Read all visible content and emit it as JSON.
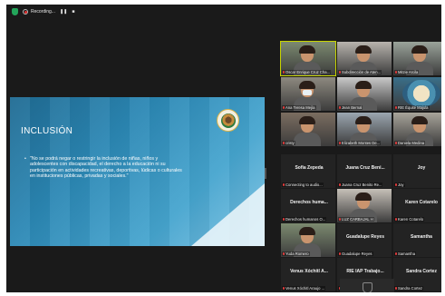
{
  "app": {
    "recording_label": "Recording...",
    "pause_glyph": "❚❚",
    "stop_glyph": "■"
  },
  "slide": {
    "title": "INCLUSIÓN",
    "bullet": "\"No se podrá negar o restringir la inclusión de niñas, niños y adolescentes con discapacidad, el derecho a la educación ni su participación en actividades recreativas, deportivas, lúdicas o culturales en instituciones públicas, privadas y sociales.\""
  },
  "participants": [
    {
      "label": "Oscar Enrique Cruz Cha...",
      "name": "",
      "video": true,
      "active": true
    },
    {
      "label": "Subdirección de Aten...",
      "name": "",
      "video": true
    },
    {
      "label": "Mitzie Arcila",
      "name": "",
      "video": true
    },
    {
      "label": "Ana Teresa Mejía",
      "name": "",
      "video": true
    },
    {
      "label": "Jean Bernal",
      "name": "",
      "video": true
    },
    {
      "label": "RIE Équité Majula",
      "name": "",
      "video": true
    },
    {
      "label": "cristy",
      "name": "",
      "video": true
    },
    {
      "label": "Elizabeth Montes De...",
      "name": "",
      "video": true
    },
    {
      "label": "Daniela Medina",
      "name": "",
      "video": true
    },
    {
      "label": "Connecting to audio...",
      "name": "Sofia Zepeda",
      "video": false
    },
    {
      "label": "Juana Cruz Benito Re...",
      "name": "Juana Cruz Beni...",
      "video": false
    },
    {
      "label": "Joy",
      "name": "Joy",
      "video": false
    },
    {
      "label": "Derechos humanos O...",
      "name": "Derechos  huma...",
      "video": false
    },
    {
      "label": "LUZ CARBAJAL H",
      "name": "",
      "video": true
    },
    {
      "label": "Karen Cotarelo",
      "name": "Karen Cotarelo",
      "video": false
    },
    {
      "label": "Yuda Romero",
      "name": "",
      "video": true
    },
    {
      "label": "Guadalupe Reyes",
      "name": "Guadalupe Reyes",
      "video": false
    },
    {
      "label": "Samantha",
      "name": "Samantha",
      "video": false
    },
    {
      "label": "Venus Xóchitl Araujo ...",
      "name": "Venus Xóchitl A...",
      "video": false
    },
    {
      "label": "RIE IAP Trabajo Social",
      "name": "RIE IAP Trabajo...",
      "video": false
    },
    {
      "label": "Sandra Cortez",
      "name": "Sandra Cortez",
      "video": false
    }
  ]
}
